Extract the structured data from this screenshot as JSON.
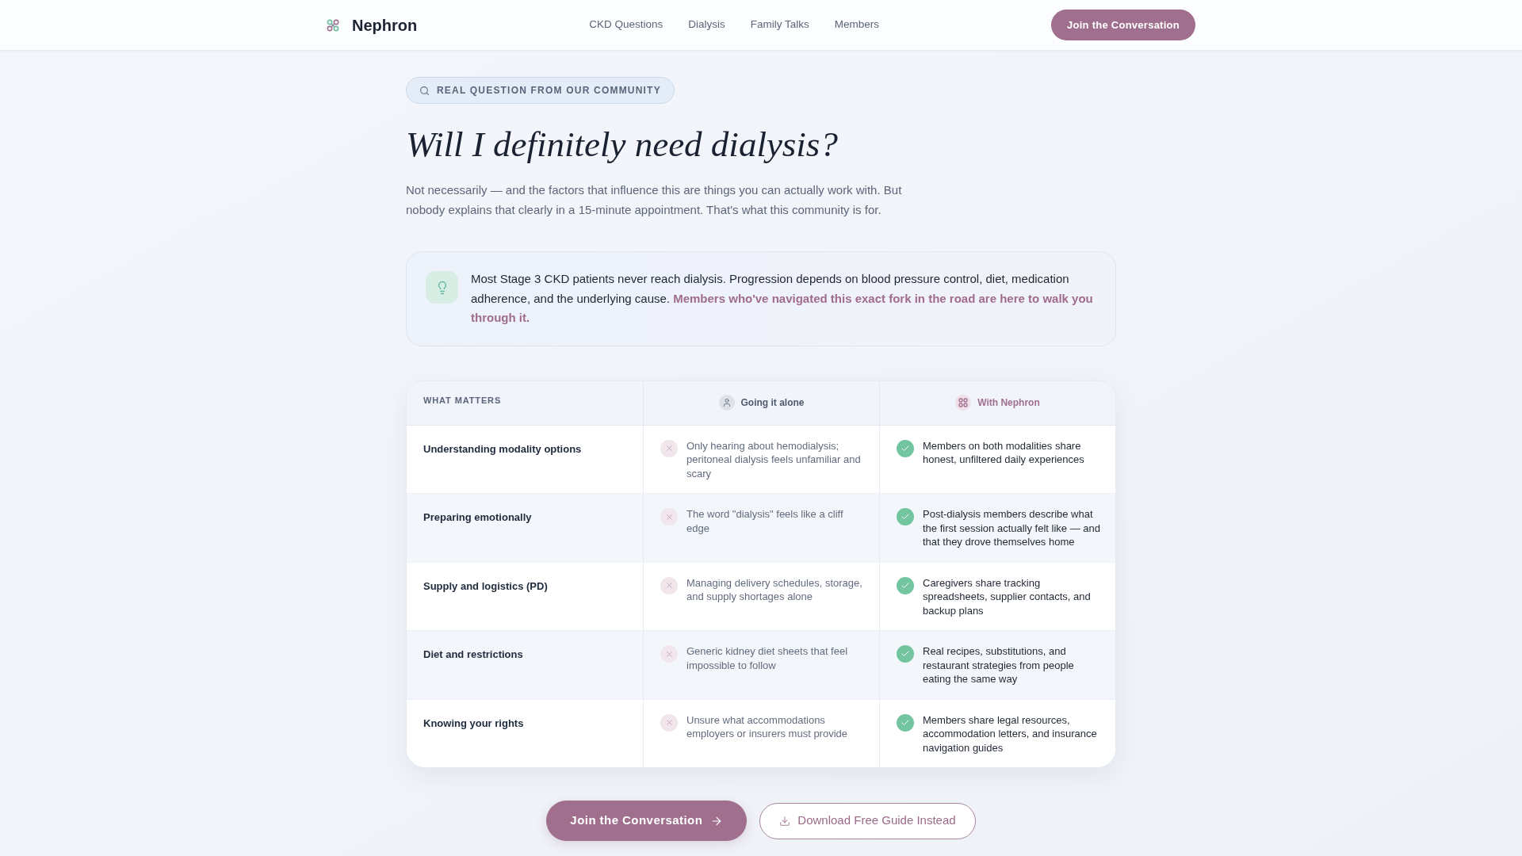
{
  "header": {
    "brand": "Nephron",
    "nav": [
      "CKD Questions",
      "Dialysis",
      "Family Talks",
      "Members"
    ],
    "cta": "Join the Conversation"
  },
  "hero": {
    "badge": "REAL QUESTION FROM OUR COMMUNITY",
    "title": "Will I definitely need dialysis?",
    "intro": "Not necessarily — and the factors that influence this are things you can actually work with. But nobody explains that clearly in a 15-minute appointment. That's what this community is for."
  },
  "callout": {
    "text": "Most Stage 3 CKD patients never reach dialysis. Progression depends on blood pressure control, diet, medication adherence, and the underlying cause. **Members who've navigated this exact fork in the road are here to walk you through it.**"
  },
  "comparison": {
    "columns": [
      {
        "label": "WHAT MATTERS",
        "kind": "topic"
      },
      {
        "label": "Going it alone",
        "kind": "without"
      },
      {
        "label": "With Nephron",
        "kind": "with"
      }
    ],
    "rows": [
      {
        "cells": [
          "Understanding modality options",
          "Only hearing about hemodialysis; peritoneal dialysis feels unfamiliar and scary",
          "Members on both modalities share honest, unfiltered daily experiences"
        ]
      },
      {
        "cells": [
          "Preparing emotionally",
          "The word \"dialysis\" feels like a cliff edge",
          "Post-dialysis members describe what the first session actually felt like — and that they drove themselves home"
        ]
      },
      {
        "cells": [
          "Supply and logistics (PD)",
          "Managing delivery schedules, storage, and supply shortages alone",
          "Caregivers share tracking spreadsheets, supplier contacts, and backup plans"
        ]
      },
      {
        "cells": [
          "Diet and restrictions",
          "Generic kidney diet sheets that feel impossible to follow",
          "Real recipes, substitutions, and restaurant strategies from people eating the same way"
        ]
      },
      {
        "cells": [
          "Knowing your rights",
          "Unsure what accommodations employers or insurers must provide",
          "Members share legal resources, accommodation letters, and insurance navigation guides"
        ]
      }
    ]
  },
  "actions": [
    {
      "label": "Join the Conversation",
      "kind": "primary"
    },
    {
      "label": "Download Free Guide Instead",
      "kind": "secondary"
    }
  ]
}
